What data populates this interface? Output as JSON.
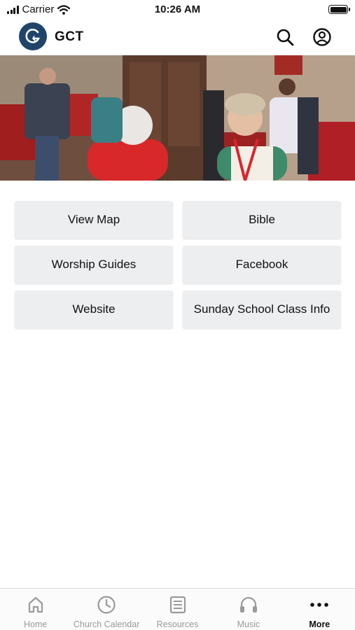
{
  "status_bar": {
    "carrier": "Carrier",
    "time": "10:26 AM"
  },
  "header": {
    "title": "GCT",
    "logo_icon": "gct-logo-icon",
    "search_icon": "search-icon",
    "account_icon": "account-icon"
  },
  "hero": {
    "description_icon": "church-gathering-photo"
  },
  "links": [
    {
      "label": "View Map"
    },
    {
      "label": "Bible"
    },
    {
      "label": "Worship Guides"
    },
    {
      "label": "Facebook"
    },
    {
      "label": "Website"
    },
    {
      "label": "Sunday School Class Info"
    }
  ],
  "tabs": [
    {
      "label": "Home",
      "icon": "home-icon"
    },
    {
      "label": "Church Calendar",
      "icon": "clock-icon"
    },
    {
      "label": "Resources",
      "icon": "document-icon"
    },
    {
      "label": "Music",
      "icon": "headphones-icon"
    },
    {
      "label": "More",
      "icon": "more-icon",
      "active": true
    }
  ],
  "colors": {
    "brand": "#21446a",
    "button_bg": "#eceeef",
    "tab_inactive": "#9a9a9a"
  }
}
